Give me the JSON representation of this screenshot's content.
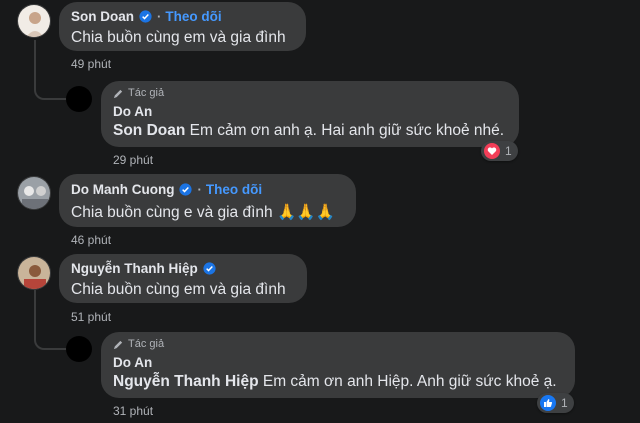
{
  "comments": [
    {
      "name": "Son Doan",
      "follow": "Theo dõi",
      "text": "Chia buồn cùng em và gia đình",
      "time": "49 phút",
      "reply": {
        "tag": "Tác giả",
        "name": "Do An",
        "mention": "Son Doan",
        "text": "Em cảm ơn anh ạ. Hai anh giữ sức khoẻ nhé.",
        "time": "29 phút",
        "reaction": {
          "type": "love",
          "count": "1"
        }
      }
    },
    {
      "name": "Do Manh Cuong",
      "follow": "Theo dõi",
      "text": "Chia buồn cùng e và gia đình 🙏🙏🙏",
      "time": "46 phút"
    },
    {
      "name": "Nguyễn Thanh Hiệp",
      "text": "Chia buồn cùng em và gia đình",
      "time": "51 phút",
      "reply": {
        "tag": "Tác giả",
        "name": "Do An",
        "mention": "Nguyễn Thanh Hiệp",
        "text": "Em cảm ơn anh Hiệp. Anh giữ sức khoẻ ạ.",
        "time": "31 phút",
        "reaction": {
          "type": "like",
          "count": "1"
        }
      }
    }
  ],
  "colors": {
    "follow": "#4599ff",
    "verified": "#1b74e4",
    "love": "#f33e58",
    "like": "#1877f2"
  }
}
